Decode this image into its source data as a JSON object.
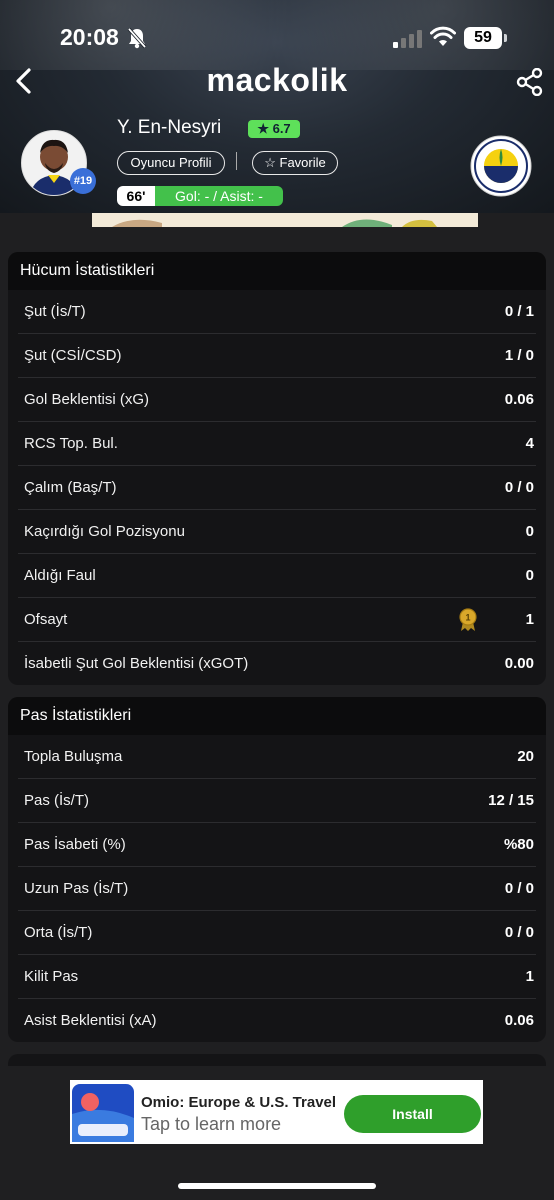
{
  "status": {
    "time": "20:08",
    "battery": "59"
  },
  "header": {
    "logo": "mackolik"
  },
  "player": {
    "name": "Y. En-Nesyri",
    "rating": "★ 6.7",
    "jersey": "#19",
    "profile_label": "Oyuncu Profili",
    "favorite_label": "Favorile",
    "minute": "66'",
    "goals_assists": "Gol: - / Asist: -"
  },
  "attack": {
    "title": "Hücum İstatistikleri",
    "rows": [
      {
        "label": "Şut (İs/T)",
        "value": "0 / 1"
      },
      {
        "label": "Şut (CSİ/CSD)",
        "value": "1 / 0"
      },
      {
        "label": "Gol Beklentisi (xG)",
        "value": "0.06"
      },
      {
        "label": "RCS Top. Bul.",
        "value": "4"
      },
      {
        "label": "Çalım (Baş/T)",
        "value": "0 / 0"
      },
      {
        "label": "Kaçırdığı Gol Pozisyonu",
        "value": "0"
      },
      {
        "label": "Aldığı Faul",
        "value": "0"
      },
      {
        "label": "Ofsayt",
        "value": "1"
      },
      {
        "label": "İsabetli Şut Gol Beklentisi (xGOT)",
        "value": "0.00"
      }
    ]
  },
  "pass": {
    "title": "Pas İstatistikleri",
    "rows": [
      {
        "label": "Topla Buluşma",
        "value": "20"
      },
      {
        "label": "Pas (İs/T)",
        "value": "12 / 15"
      },
      {
        "label": "Pas İsabeti (%)",
        "value": "%80"
      },
      {
        "label": "Uzun Pas (İs/T)",
        "value": "0 / 0"
      },
      {
        "label": "Orta (İs/T)",
        "value": "0 / 0"
      },
      {
        "label": "Kilit Pas",
        "value": "1"
      },
      {
        "label": "Asist Beklentisi (xA)",
        "value": "0.06"
      }
    ]
  },
  "ad": {
    "title": "Omio: Europe & U.S. Travel",
    "subtitle": "Tap to learn more",
    "button": "Install"
  },
  "colors": {
    "accent_green": "#43c14b",
    "rating_green": "#5ee05a",
    "install_green": "#2f9f2b",
    "jersey_blue": "#3a6fd8",
    "medal_gold": "#d9a82a"
  }
}
